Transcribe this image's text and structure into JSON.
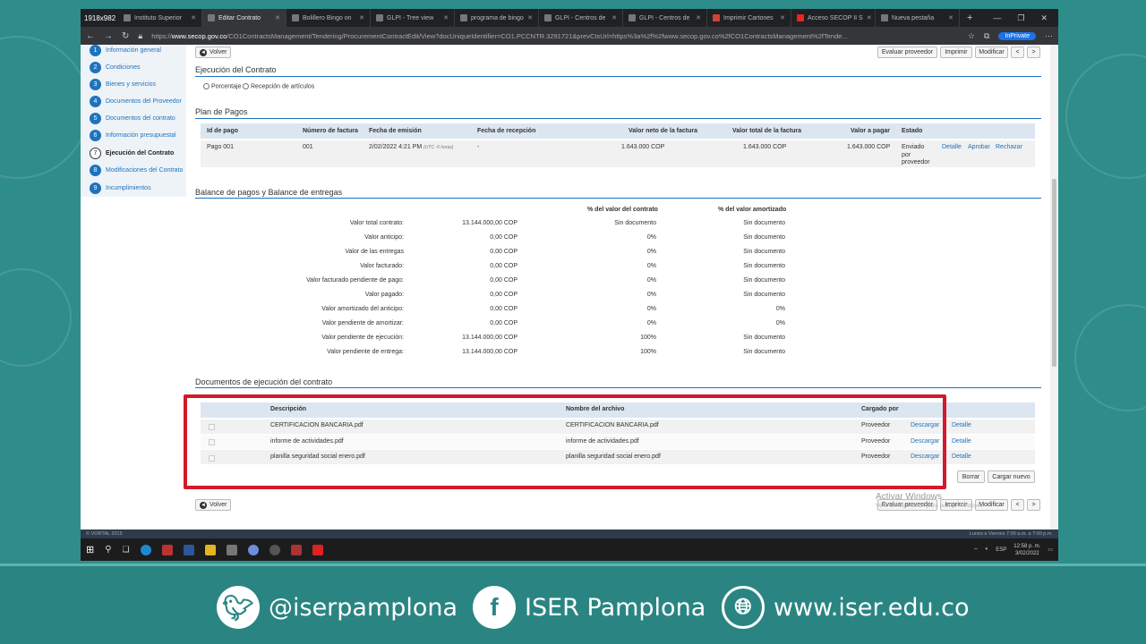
{
  "browser": {
    "size_label": "1918x982",
    "tabs": [
      {
        "label": "Instituto Superior"
      },
      {
        "label": "Editar Contrato",
        "active": true
      },
      {
        "label": "Bolillero Bingo on"
      },
      {
        "label": "GLPI - Tree view"
      },
      {
        "label": "programa de bingo"
      },
      {
        "label": "GLPI - Centros de"
      },
      {
        "label": "GLPI - Centros de"
      },
      {
        "label": "Imprimir Cartones"
      },
      {
        "label": "Acceso SECOP II S"
      },
      {
        "label": "Nueva pestaña"
      }
    ],
    "url_prefix": "https://",
    "url_host": "www.secop.gov.co",
    "url_rest": "/CO1ContractsManagement/Tendering/ProcurementContractEdit/View?docUniqueIdentifier=CO1.PCCNTR.3291721&prevCtxUrl=https%3a%2f%2fwww.secop.gov.co%2fCO1ContractsManagement%2fTende...",
    "inprivate": "InPrivate"
  },
  "sidenav": {
    "items": [
      {
        "num": "1",
        "label": "Información general"
      },
      {
        "num": "2",
        "label": "Condiciones"
      },
      {
        "num": "3",
        "label": "Bienes y servicios"
      },
      {
        "num": "4",
        "label": "Documentos del Proveedor"
      },
      {
        "num": "5",
        "label": "Documentos del contrato"
      },
      {
        "num": "6",
        "label": "Información presupuestal"
      },
      {
        "num": "7",
        "label": "Ejecución del Contrato"
      },
      {
        "num": "8",
        "label": "Modificaciones del Contrato"
      },
      {
        "num": "9",
        "label": "Incumplimientos"
      }
    ]
  },
  "toolbar": {
    "volver": "Volver",
    "evaluar": "Evaluar proveedor",
    "imprimir": "Imprimir",
    "modificar": "Modificar",
    "prev": "<",
    "next": ">"
  },
  "ejecucion": {
    "title": "Ejecución del Contrato",
    "opt1": "Porcentaje",
    "opt2": "Recepción de artículos"
  },
  "plan": {
    "title": "Plan de Pagos",
    "headers": [
      "Id de pago",
      "Número de factura",
      "Fecha de emisión",
      "Fecha de recepción",
      "Valor neto de la factura",
      "Valor total de la factura",
      "Valor a pagar",
      "Estado"
    ],
    "row": {
      "id": "Pago 001",
      "factura": "001",
      "fecha": "2/02/2022 4:21 PM",
      "tz": "(UTC -5 horas)",
      "recepcion": "-",
      "neto": "1.643.000 COP",
      "total": "1.643.000 COP",
      "pagar": "1.643.000 COP",
      "estado1": "Enviado",
      "estado2": "por",
      "estado3": "proveedor",
      "detalle": "Detalle",
      "aprobar": "Aprobar",
      "rechazar": "Rechazar"
    }
  },
  "balance": {
    "title": "Balance de pagos y Balance de entregas",
    "col_contrato": "% del valor del contrato",
    "col_amortizado": "% del valor amortizado",
    "rows": [
      {
        "label": "Valor total contrato:",
        "value": "13.144.000,00 COP",
        "pct": "Sin documento",
        "amort": "Sin documento"
      },
      {
        "label": "Valor anticipo:",
        "value": "0,00 COP",
        "pct": "0%",
        "amort": "Sin documento"
      },
      {
        "label": "Valor de las entregas",
        "value": "0,00 COP",
        "pct": "0%",
        "amort": "Sin documento"
      },
      {
        "label": "Valor facturado:",
        "value": "0,00 COP",
        "pct": "0%",
        "amort": "Sin documento"
      },
      {
        "label": "Valor facturado pendiente de pago:",
        "value": "0,00 COP",
        "pct": "0%",
        "amort": "Sin documento"
      },
      {
        "label": "Valor pagado:",
        "value": "0,00 COP",
        "pct": "0%",
        "amort": "Sin documento"
      },
      {
        "label": "Valor amortizado del anticipo:",
        "value": "0,00 COP",
        "pct": "0%",
        "amort": "0%"
      },
      {
        "label": "Valor pendiente de amortizar:",
        "value": "0,00 COP",
        "pct": "0%",
        "amort": "0%"
      },
      {
        "label": "Valor pendiente de ejecución:",
        "value": "13.144.000,00 COP",
        "pct": "100%",
        "amort": "Sin documento"
      },
      {
        "label": "Valor pendiente de entrega:",
        "value": "13.144.000,00 COP",
        "pct": "100%",
        "amort": "Sin documento"
      }
    ]
  },
  "documentos": {
    "title": "Documentos de ejecución del contrato",
    "headers": [
      "Descripción",
      "Nombre del archivo",
      "Cargado por"
    ],
    "rows": [
      {
        "desc": "CERTIFICACION BANCARIA.pdf",
        "file": "CERTIFICACION BANCARIA.pdf",
        "by": "Proveedor",
        "descargar": "Descargar",
        "detalle": "Detalle"
      },
      {
        "desc": "informe de actividades.pdf",
        "file": "informe de actividades.pdf",
        "by": "Proveedor",
        "descargar": "Descargar",
        "detalle": "Detalle"
      },
      {
        "desc": "planilla seguridad social enero.pdf",
        "file": "planilla seguridad social enero.pdf",
        "by": "Proveedor",
        "descargar": "Descargar",
        "detalle": "Detalle"
      }
    ],
    "borrar": "Borrar",
    "cargar": "Cargar nuevo"
  },
  "watermark": {
    "line1": "Activar Windows",
    "line2": "Ve a Configuración para activar Windows."
  },
  "statusbar": {
    "left": "© VORTAL 2015",
    "right": "Lunes a Viernes 7:00 a.m. a 7:00 p.m."
  },
  "taskbar": {
    "lang": "ESP",
    "time": "12:58 p. m.",
    "date": "3/02/2022"
  },
  "footer": {
    "twitter": "@iserpamplona",
    "facebook": "ISER Pamplona",
    "web": "www.iser.edu.co"
  }
}
